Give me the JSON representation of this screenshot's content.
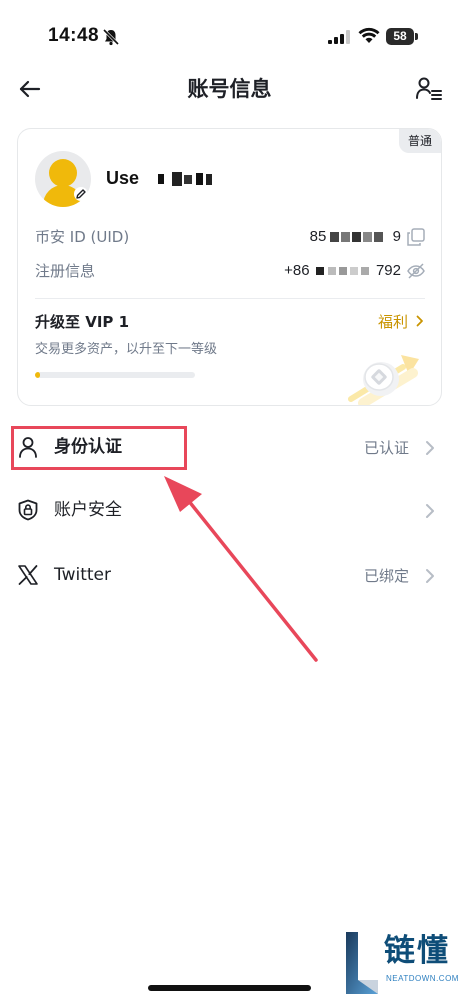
{
  "status_bar": {
    "time": "14:48",
    "battery": "58",
    "icons": [
      "bell-slash-icon",
      "signal-icon",
      "wifi-icon",
      "battery-icon"
    ]
  },
  "header": {
    "title": "账号信息",
    "back_icon": "arrow-left-icon",
    "right_icon": "user-list-icon"
  },
  "account_card": {
    "badge": "普通",
    "username": "Use",
    "uid_label": "币安 ID (UID)",
    "uid_value": "85",
    "uid_value_tail": "9",
    "copy_icon": "copy-icon",
    "register_label": "注册信息",
    "register_prefix": "+86",
    "register_suffix": "792",
    "eye_icon": "eye-slash-icon",
    "vip_title": "升级至 VIP 1",
    "vip_link": "福利",
    "vip_desc": "交易更多资产，以升至下一等级",
    "vip_progress": 0.03
  },
  "menu": {
    "items": [
      {
        "label": "身份认证",
        "status": "已认证",
        "icon": "person-icon"
      },
      {
        "label": "账户安全",
        "status": "",
        "icon": "shield-lock-icon"
      },
      {
        "label": "Twitter",
        "status": "已绑定",
        "icon": "x-logo-icon"
      }
    ]
  },
  "annotation": {
    "color": "#e8475a"
  },
  "watermark": {
    "brand": "链懂",
    "domain": "NEATDOWN.COM"
  },
  "colors": {
    "brand_yellow": "#f0b90b",
    "link_gold": "#c99400",
    "text_primary": "#1e2026",
    "text_secondary": "#707a8a"
  }
}
